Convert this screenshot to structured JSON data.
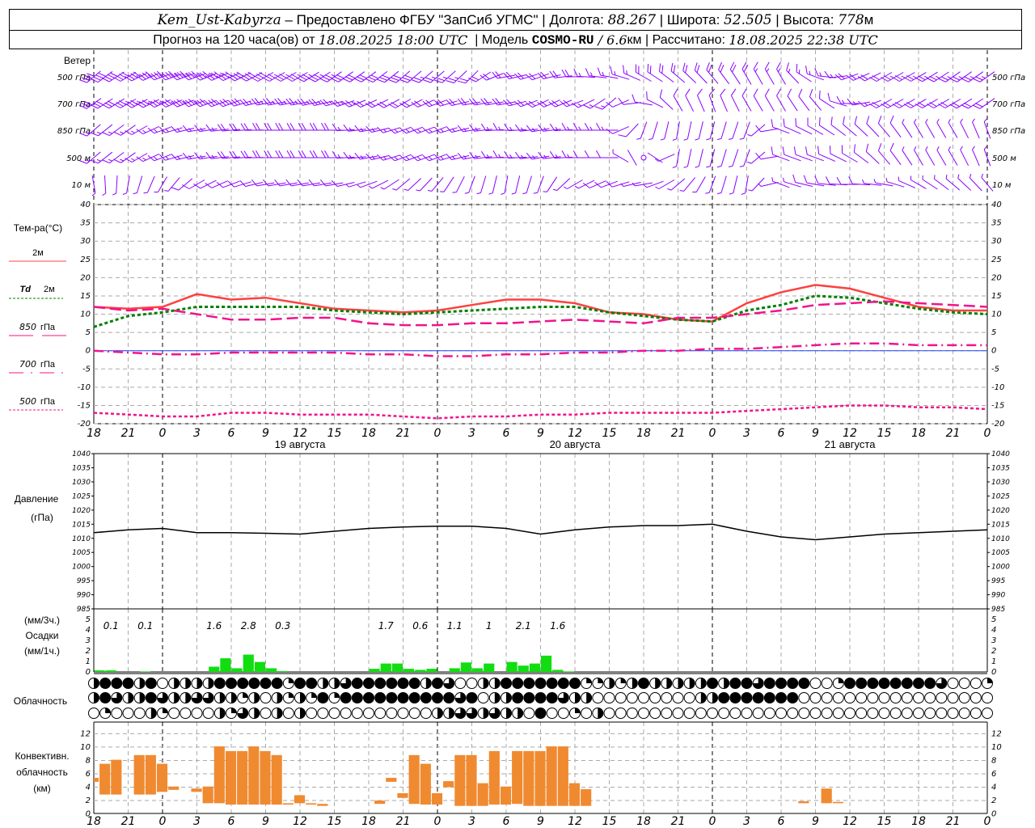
{
  "header": {
    "station": "Kem_Ust-Kabyrza",
    "provider": " – Предоставлено ФГБУ \"ЗапСиб УГМС\" | Долгота: ",
    "lon": "88.267",
    "lat_label": " | Широта: ",
    "lat": "52.505",
    "alt_label": " | Высота: ",
    "alt": "778",
    "alt_unit": "м",
    "forecast_label": "Прогноз на 120 часа(ов) от ",
    "forecast_start": "18.08.2025 18:00 UTC",
    "model_label": "  | Модель ",
    "model": "COSMO-RU",
    "resolution": " / 6.6",
    "res_unit": "км",
    "computed_label": " | Рассчитано: ",
    "computed": "18.08.2025 22:38 UTC"
  },
  "labels": {
    "wind": "Ветер",
    "temp": "Тем-ра(°C)",
    "t2m": "2м",
    "td": "Td",
    "td2m": "2м",
    "t850": "850",
    "t700": "700",
    "t500": "500",
    "hpa": "гПа",
    "pressure": "Давление",
    "pressure_unit": "(гПа)",
    "precip3": "(мм/3ч.)",
    "precip": "Осадки",
    "precip1": "(мм/1ч.)",
    "clouds": "Облачность",
    "conv1": "Конвективн.",
    "conv2": "облачность",
    "conv3": "(км)"
  },
  "colors": {
    "wind": "#8a00ff",
    "t2m": "#ff4040",
    "td": "#008000",
    "upper": "#f0148c",
    "zero_line": "#2040ff",
    "precip": "#11dd11",
    "convective": "#f08a30"
  },
  "chart_data": {
    "type": "meteogram",
    "hour_ticks": [
      "18",
      "21",
      "0",
      "3",
      "6",
      "9",
      "12",
      "15",
      "18",
      "21",
      "0",
      "3",
      "6",
      "9",
      "12",
      "15",
      "18",
      "21",
      "0",
      "3",
      "6",
      "9",
      "12",
      "15",
      "18",
      "21",
      "0"
    ],
    "dates": [
      "19 августа",
      "20 августа",
      "21 августа"
    ],
    "wind": {
      "levels": [
        {
          "label": "500",
          "unit": "гПа",
          "dir": [
            230,
            240,
            250,
            250,
            245,
            240,
            240,
            235,
            235,
            230,
            230,
            225,
            260,
            250,
            270,
            280,
            300,
            310,
            320,
            330,
            330,
            290,
            250,
            240,
            240,
            235,
            235
          ],
          "speed": [
            20,
            22,
            22,
            24,
            22,
            20,
            18,
            18,
            16,
            16,
            14,
            12,
            10,
            10,
            10,
            8,
            10,
            10,
            10,
            10,
            8,
            8,
            10,
            12,
            14,
            14,
            14
          ]
        },
        {
          "label": "700",
          "unit": "гПа",
          "dir": [
            235,
            240,
            245,
            250,
            250,
            260,
            260,
            255,
            245,
            240,
            250,
            260,
            260,
            245,
            250,
            230,
            280,
            330,
            340,
            330,
            330,
            320,
            270,
            240,
            240,
            240,
            235
          ],
          "speed": [
            16,
            18,
            18,
            18,
            16,
            14,
            14,
            14,
            12,
            12,
            12,
            12,
            12,
            12,
            10,
            8,
            6,
            6,
            6,
            6,
            6,
            6,
            8,
            10,
            12,
            12,
            12
          ]
        },
        {
          "label": "850",
          "unit": "гПа",
          "dir": [
            230,
            235,
            250,
            260,
            265,
            270,
            270,
            270,
            260,
            250,
            250,
            260,
            270,
            260,
            270,
            270,
            200,
            190,
            195,
            200,
            290,
            300,
            310,
            320,
            330,
            330,
            340
          ],
          "speed": [
            8,
            8,
            8,
            8,
            10,
            10,
            10,
            10,
            8,
            8,
            8,
            8,
            8,
            8,
            8,
            8,
            4,
            4,
            4,
            4,
            6,
            6,
            6,
            6,
            4,
            4,
            4
          ]
        },
        {
          "label": "500",
          "unit": "м",
          "dir": [
            230,
            235,
            250,
            260,
            265,
            270,
            270,
            270,
            260,
            250,
            250,
            260,
            270,
            260,
            270,
            270,
            0,
            190,
            195,
            200,
            290,
            290,
            300,
            320,
            330,
            330,
            340
          ],
          "speed": [
            8,
            8,
            8,
            8,
            10,
            10,
            10,
            10,
            8,
            8,
            8,
            8,
            8,
            8,
            8,
            6,
            0,
            4,
            4,
            4,
            6,
            6,
            6,
            6,
            4,
            4,
            4
          ]
        },
        {
          "label": "10",
          "unit": "м",
          "dir": [
            170,
            190,
            210,
            240,
            250,
            260,
            260,
            260,
            250,
            230,
            220,
            200,
            190,
            200,
            240,
            250,
            260,
            230,
            200,
            190,
            290,
            280,
            270,
            280,
            300,
            310,
            320
          ],
          "speed": [
            4,
            4,
            4,
            6,
            6,
            6,
            6,
            6,
            4,
            4,
            4,
            4,
            4,
            4,
            4,
            6,
            4,
            4,
            4,
            4,
            4,
            6,
            6,
            4,
            4,
            4,
            4
          ]
        }
      ]
    },
    "temperature": {
      "ylim": [
        -20,
        40
      ],
      "yticks": [
        "40",
        "35",
        "30",
        "25",
        "20",
        "15",
        "10",
        "5",
        "0",
        "-5",
        "-10",
        "-15",
        "-20"
      ],
      "series": [
        {
          "name": "2м",
          "values": [
            12,
            11.5,
            12,
            15.5,
            14,
            14.5,
            13,
            11.5,
            11,
            10.5,
            11,
            12.5,
            14,
            14,
            13,
            10.5,
            10,
            8.5,
            8,
            13,
            16,
            18,
            17,
            14.5,
            12,
            11,
            11
          ]
        },
        {
          "name": "Td 2м",
          "values": [
            6.5,
            9.5,
            10.5,
            12,
            12,
            12,
            12,
            11,
            10.5,
            10,
            10.5,
            11,
            11.5,
            12,
            12,
            10.5,
            9.5,
            8.5,
            8,
            11,
            12.5,
            15,
            14.5,
            13,
            11.5,
            10.5,
            10
          ]
        },
        {
          "name": "850 гПа",
          "values": [
            12,
            11,
            11.5,
            10,
            8.5,
            8.5,
            9,
            9,
            7.5,
            7,
            7,
            7.5,
            7.5,
            8,
            8.5,
            8,
            7.5,
            9,
            9,
            10,
            11,
            12.5,
            13,
            13.5,
            13,
            12.5,
            12
          ]
        },
        {
          "name": "700 гПа",
          "values": [
            0,
            -0.5,
            -1,
            -1,
            -0.5,
            -0.5,
            -0.5,
            -0.5,
            -1,
            -1,
            -1.5,
            -1.5,
            -1,
            -1,
            -0.5,
            -0.5,
            0,
            0,
            0.5,
            0.5,
            1,
            1.5,
            2,
            2,
            1.5,
            1.5,
            1.5
          ]
        },
        {
          "name": "500 гПа",
          "values": [
            -17,
            -17.5,
            -18,
            -18,
            -17,
            -17,
            -17.5,
            -17.5,
            -17.5,
            -18,
            -18.5,
            -18,
            -18,
            -17.5,
            -17.5,
            -17,
            -17,
            -17,
            -17,
            -16.5,
            -16,
            -15.5,
            -15,
            -15,
            -15.5,
            -15.5,
            -16
          ]
        }
      ]
    },
    "pressure": {
      "ylim": [
        985,
        1040
      ],
      "yticks": [
        "1040",
        "1035",
        "1030",
        "1025",
        "1020",
        "1015",
        "1010",
        "1005",
        "1000",
        "995",
        "990",
        "985"
      ],
      "values": [
        1012,
        1013,
        1013.5,
        1012,
        1012,
        1011.8,
        1011.5,
        1012.5,
        1013.5,
        1014,
        1014.3,
        1014.3,
        1013.5,
        1011.5,
        1013,
        1014,
        1014.5,
        1014.5,
        1015,
        1012.5,
        1010.5,
        1009.5,
        1010.5,
        1011.5,
        1012,
        1012.5,
        1013
      ]
    },
    "precipitation": {
      "ylim": [
        0,
        5
      ],
      "yticks": [
        "5",
        "4",
        "3",
        "2",
        "1",
        "0"
      ],
      "hourly": [
        0.15,
        0.15,
        0,
        0,
        0.05,
        0,
        0,
        0,
        0,
        0,
        0.5,
        1.3,
        0.35,
        1.65,
        0.95,
        0.35,
        0.08,
        0,
        0,
        0,
        0,
        0,
        0,
        0,
        0.3,
        0.8,
        0.8,
        0.3,
        0.2,
        0.3,
        0,
        0.35,
        0.9,
        0.35,
        0.8,
        0,
        0.95,
        0.6,
        0.8,
        1.55,
        0.2,
        0.05,
        0,
        0,
        0,
        0,
        0,
        0,
        0,
        0,
        0,
        0,
        0,
        0,
        0,
        0,
        0,
        0,
        0,
        0,
        0,
        0,
        0,
        0,
        0,
        0,
        0,
        0,
        0,
        0,
        0,
        0,
        0,
        0,
        0,
        0,
        0,
        0
      ],
      "three_hourly": [
        "0.1",
        "0.1",
        "",
        "1.6",
        "2.8",
        "0.3",
        "",
        "",
        "1.7",
        "0.6",
        "1.1",
        "1",
        "2.1",
        "1.6",
        "",
        "",
        "",
        "",
        "",
        "",
        "",
        "",
        "",
        "",
        "",
        "",
        ""
      ]
    },
    "cloud_cover_quarters": [
      "2444240222244444414422344444424300224444444112124222224244344440014444444430001",
      "2432243223322120212141444444444434022444432200000000022444444400000000000000000",
      "0100021000021320202000000000002233232204001020000000000000000000000000000000000"
    ],
    "convective": {
      "ylim": [
        0,
        12
      ],
      "yticks": [
        "12",
        "10",
        "8",
        "6",
        "4",
        "2",
        "0"
      ],
      "base_top_km": [
        [
          4.8,
          5.4
        ],
        [
          2.9,
          7.5
        ],
        [
          2.9,
          8.1
        ],
        null,
        [
          2.9,
          8.8
        ],
        [
          2.9,
          8.8
        ],
        [
          3.3,
          7.5
        ],
        [
          3.6,
          4.1
        ],
        null,
        [
          3.3,
          3.8
        ],
        [
          1.6,
          4.1
        ],
        [
          1.6,
          10.1
        ],
        [
          1.4,
          9.4
        ],
        [
          1.4,
          9.4
        ],
        [
          1.4,
          10.1
        ],
        [
          1.4,
          9.4
        ],
        [
          1.4,
          8.8
        ],
        [
          1.4,
          1.6
        ],
        [
          1.6,
          2.8
        ],
        [
          1.4,
          1.6
        ],
        [
          1.2,
          1.5
        ],
        null,
        null,
        null,
        null,
        [
          1.5,
          2.0
        ],
        [
          4.8,
          5.4
        ],
        [
          2.4,
          3.1
        ],
        [
          1.5,
          8.8
        ],
        [
          1.4,
          7.5
        ],
        [
          1.4,
          3.1
        ],
        [
          4.0,
          4.9
        ],
        [
          1.2,
          8.8
        ],
        [
          1.2,
          8.8
        ],
        [
          1.2,
          4.6
        ],
        [
          1.4,
          9.4
        ],
        [
          1.4,
          4.1
        ],
        [
          1.5,
          9.4
        ],
        [
          1.2,
          9.4
        ],
        [
          1.2,
          9.4
        ],
        [
          1.2,
          10.1
        ],
        [
          1.2,
          10.1
        ],
        [
          1.2,
          4.6
        ],
        [
          1.2,
          3.7
        ],
        null,
        null,
        null,
        null,
        null,
        null,
        null,
        null,
        null,
        null,
        null,
        null,
        null,
        null,
        null,
        null,
        null,
        null,
        [
          1.6,
          1.9
        ],
        null,
        [
          1.6,
          3.8
        ],
        [
          1.6,
          1.8
        ],
        null,
        null,
        null,
        null,
        null,
        null,
        null,
        null,
        null,
        null,
        null,
        null,
        null
      ]
    }
  }
}
